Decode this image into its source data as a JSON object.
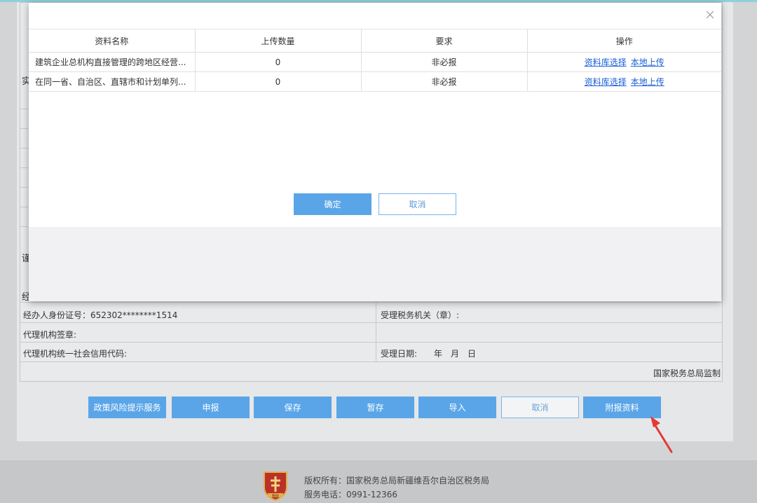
{
  "modal": {
    "columns": [
      "资料名称",
      "上传数量",
      "要求",
      "操作"
    ],
    "rows": [
      {
        "name": "建筑企业总机构直接管理的跨地区经营...",
        "count": "0",
        "requirement": "非必报",
        "action1": "资料库选择",
        "action2": "本地上传"
      },
      {
        "name": "在同一省、自治区、直辖市和计划单列...",
        "count": "0",
        "requirement": "非必报",
        "action1": "资料库选择",
        "action2": "本地上传"
      }
    ],
    "confirm_label": "确定",
    "cancel_label": "取消"
  },
  "form": {
    "edge_chars": [
      "实",
      "谨",
      "经"
    ],
    "agent_id": "经办人身份证号：652302********1514",
    "agency_signature": "代理机构签章:",
    "agency_credit_code": "代理机构统一社会信用代码:",
    "tax_authority": "受理税务机关（章）:",
    "accept_date": "受理日期:　　年　月　日",
    "supervision": "国家税务总局监制"
  },
  "actions": [
    {
      "label": "政策风险提示服务"
    },
    {
      "label": "申报"
    },
    {
      "label": "保存"
    },
    {
      "label": "暂存"
    },
    {
      "label": "导入"
    },
    {
      "label": "取消"
    },
    {
      "label": "附报资料"
    }
  ],
  "footer": {
    "copyright": "版权所有：国家税务总局新疆维吾尔自治区税务局",
    "phone": "服务电话：0991-12366",
    "logo_text": "税收"
  },
  "colors": {
    "primary_button": "#5aa5e8",
    "link": "#1a5fd6",
    "arrow": "#e53935"
  }
}
